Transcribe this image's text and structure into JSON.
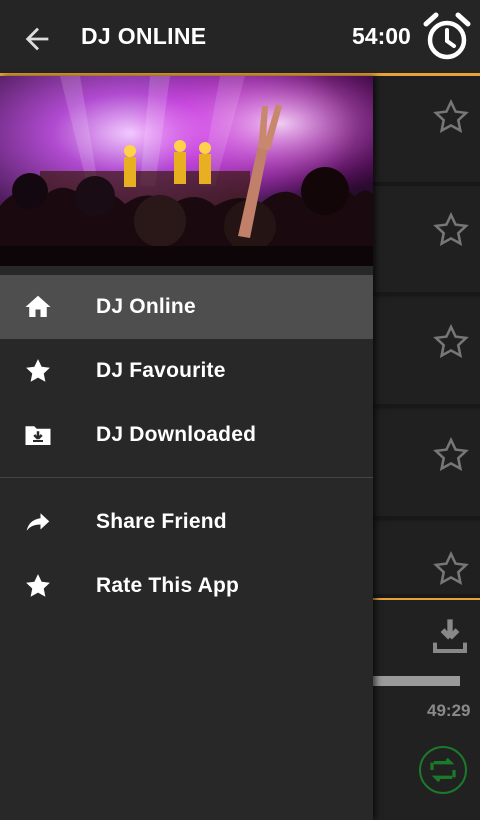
{
  "app_bar": {
    "title": "DJ ONLINE",
    "timer": "54:00",
    "back_icon": "arrow-left-icon",
    "alarm_icon": "alarm-clock-icon"
  },
  "drawer": {
    "menu": [
      {
        "label": "DJ Online",
        "icon": "home-icon",
        "active": true
      },
      {
        "label": "DJ Favourite",
        "icon": "star-icon",
        "active": false
      },
      {
        "label": "DJ Downloaded",
        "icon": "folder-download-icon",
        "active": false
      }
    ],
    "secondary": [
      {
        "label": "Share Friend",
        "icon": "share-arrow-icon"
      },
      {
        "label": "Rate This App",
        "icon": "star-icon"
      }
    ]
  },
  "player": {
    "time_total": "49:29",
    "progress": 1.0
  },
  "colors": {
    "accent": "#e8a23a",
    "active_item": "#4e4e4e",
    "drawer_bg": "#282828",
    "repeat": "#1a7a2a"
  }
}
